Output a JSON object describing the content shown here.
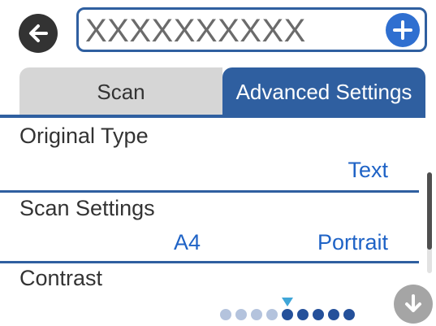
{
  "header": {
    "name_value": "XXXXXXXXXX"
  },
  "tabs": [
    {
      "label": "Scan",
      "active": false
    },
    {
      "label": "Advanced Settings",
      "active": true
    }
  ],
  "settings": {
    "original_type": {
      "label": "Original Type",
      "value": "Text"
    },
    "scan_settings": {
      "label": "Scan Settings",
      "size": "A4",
      "orientation": "Portrait"
    },
    "contrast": {
      "label": "Contrast",
      "level": 5,
      "levels": 9
    }
  },
  "colors": {
    "accent": "#2f5fa0",
    "value_text": "#1f63c6",
    "slider_light": "#b4c3dd",
    "slider_dark": "#24509a",
    "slider_marker": "#3fa6d8"
  },
  "icons": {
    "back": "back-arrow-icon",
    "add": "plus-icon",
    "scroll_down": "arrow-down-icon",
    "slider_marker": "triangle-down-icon"
  }
}
